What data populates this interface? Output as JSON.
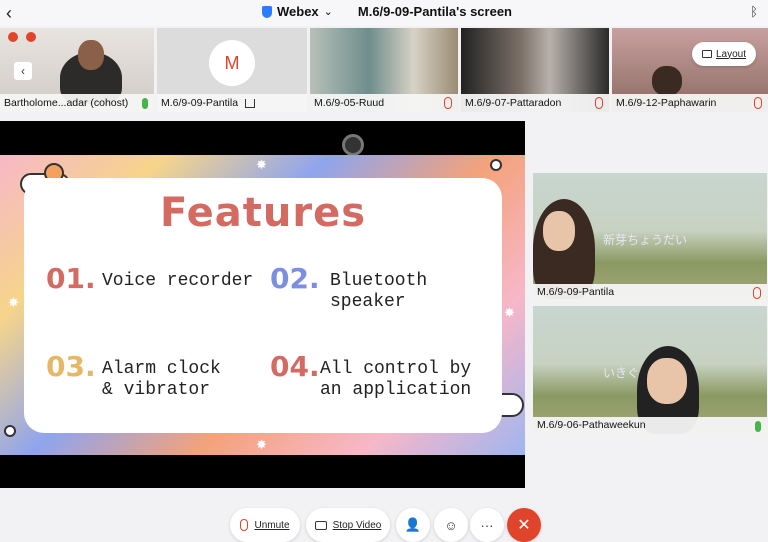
{
  "topbar": {
    "app_name": "Webex",
    "chevron": "⌄",
    "screen_title": "M.6/9-09-Pantila's screen"
  },
  "strip": {
    "tiles": [
      {
        "label": "Bartholome...adar (cohost)"
      },
      {
        "label": "M.6/9-09-Pantila",
        "avatar_letter": "M"
      },
      {
        "label": "M.6/9-05-Ruud"
      },
      {
        "label": "M.6/9-07-Pattaradon"
      },
      {
        "label": "M.6/9-12-Paphawarin"
      }
    ],
    "layout_label": "Layout"
  },
  "slide": {
    "title": "Features",
    "items": [
      {
        "num": "01.",
        "text": "Voice recorder"
      },
      {
        "num": "02.",
        "text": "Bluetooth\nspeaker"
      },
      {
        "num": "03.",
        "text": "Alarm clock\n& vibrator"
      },
      {
        "num": "04.",
        "text": "All control by\nan application"
      }
    ],
    "colors": {
      "title": "#d36b63",
      "n1": "#d36b63",
      "n2": "#7b8fe0",
      "n3": "#e6b865",
      "n4": "#d36b63"
    }
  },
  "side": {
    "tiles": [
      {
        "label": "M.6/9-09-Pantila",
        "overlay": "新芽ちょうだい"
      },
      {
        "label": "M.6/9-06-Pathaweekun",
        "overlay": "いきぐ"
      }
    ]
  },
  "controls": {
    "unmute_label": "Unmute",
    "stop_video_label": "Stop Video",
    "more_label": "···",
    "end_label": "✕"
  }
}
